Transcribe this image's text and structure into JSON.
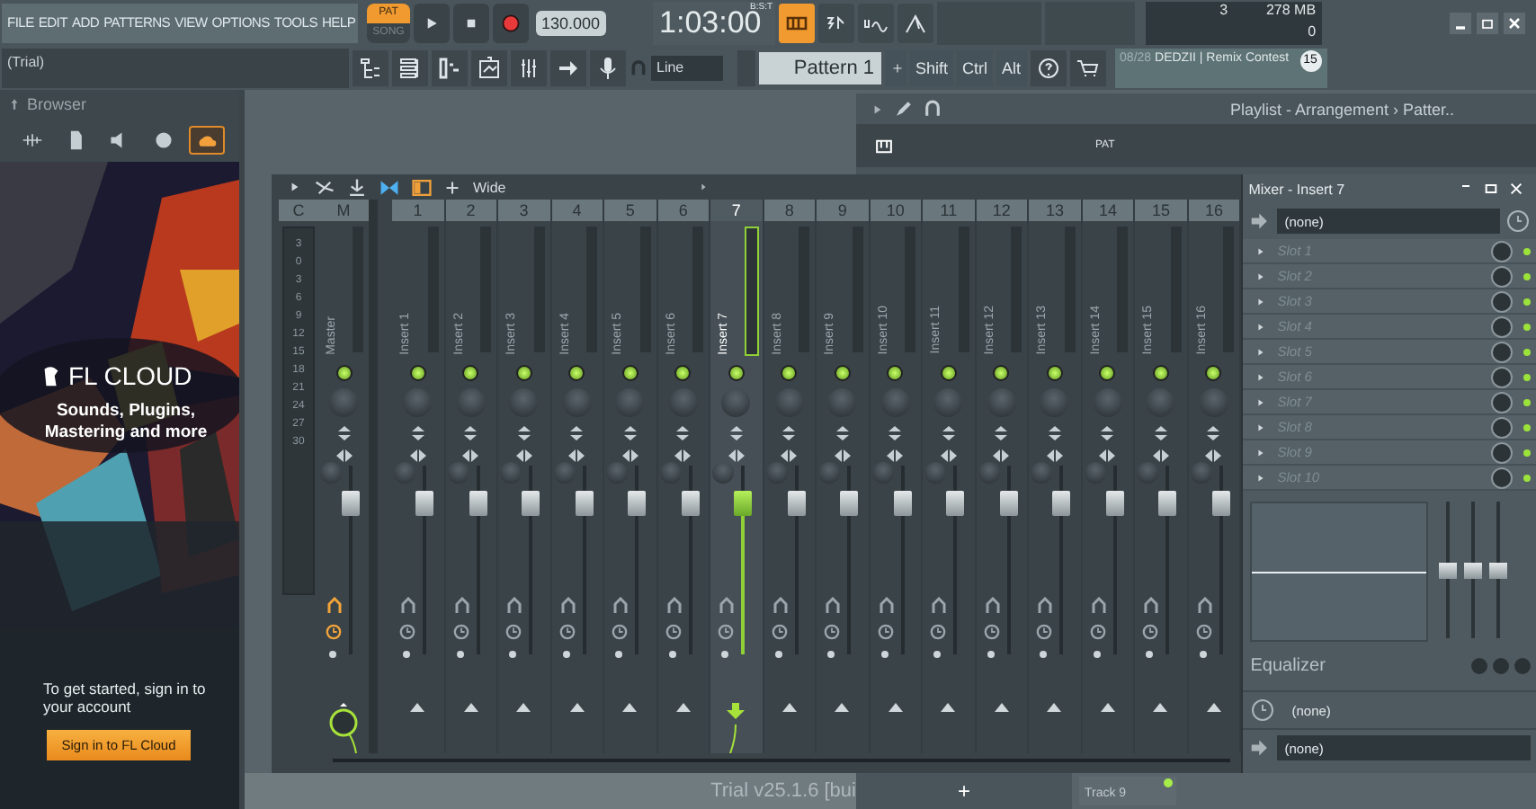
{
  "menu": [
    "FILE",
    "EDIT",
    "ADD",
    "PATTERNS",
    "VIEW",
    "OPTIONS",
    "TOOLS",
    "HELP"
  ],
  "transport": {
    "modes": [
      {
        "label": "PAT",
        "selected": true
      },
      {
        "label": "SONG",
        "selected": false
      }
    ],
    "recording": false,
    "tempo": "130.000",
    "time": "1:03:00",
    "time_unit": "B:S:T"
  },
  "hint": "(Trial)",
  "snap": "Line",
  "pattern": "Pattern 1",
  "keys": [
    "Shift",
    "Ctrl",
    "Alt"
  ],
  "monitor": {
    "cpu": "3",
    "memory": "278 MB",
    "polyphony": "0"
  },
  "news": {
    "date": "08/28",
    "title": "DEDZII | Remix Contest",
    "badge": "15"
  },
  "browser": {
    "title": "Browser",
    "tabs": [
      {
        "selected": false
      },
      {
        "selected": false
      },
      {
        "selected": false
      },
      {
        "selected": false
      },
      {
        "selected": true
      }
    ],
    "brand": "FL CLOUD",
    "tagline": "Sounds, Plugins, Mastering and more",
    "prompt": "To get started, sign in to your account",
    "button": "Sign in to FL Cloud"
  },
  "playlist": {
    "title": "Playlist - Arrangement › Patter..",
    "mode": "PAT"
  },
  "mixer": {
    "preset": "Wide",
    "scale": [
      "3",
      "0",
      "3",
      "6",
      "9",
      "12",
      "15",
      "18",
      "21",
      "24",
      "27",
      "30"
    ],
    "headers": [
      "C",
      "M",
      "1",
      "2",
      "3",
      "4",
      "5",
      "6",
      "7",
      "8",
      "9",
      "10",
      "11",
      "12",
      "13",
      "14",
      "15",
      "16"
    ],
    "tracks": [
      {
        "kind": "master",
        "name": "Master",
        "selected": false,
        "level": 0.85
      },
      {
        "kind": "insert",
        "name": "Insert 1",
        "selected": false,
        "level": 0.85
      },
      {
        "kind": "insert",
        "name": "Insert 2",
        "selected": false,
        "level": 0.85
      },
      {
        "kind": "insert",
        "name": "Insert 3",
        "selected": false,
        "level": 0.85
      },
      {
        "kind": "insert",
        "name": "Insert 4",
        "selected": false,
        "level": 0.85
      },
      {
        "kind": "insert",
        "name": "Insert 5",
        "selected": false,
        "level": 0.85
      },
      {
        "kind": "insert",
        "name": "Insert 6",
        "selected": false,
        "level": 0.85
      },
      {
        "kind": "insert",
        "name": "Insert 7",
        "selected": true,
        "level": 0.85
      },
      {
        "kind": "insert",
        "name": "Insert 8",
        "selected": false,
        "level": 0.85
      },
      {
        "kind": "insert",
        "name": "Insert 9",
        "selected": false,
        "level": 0.85
      },
      {
        "kind": "insert",
        "name": "Insert 10",
        "selected": false,
        "level": 0.85
      },
      {
        "kind": "insert",
        "name": "Insert 11",
        "selected": false,
        "level": 0.85
      },
      {
        "kind": "insert",
        "name": "Insert 12",
        "selected": false,
        "level": 0.85
      },
      {
        "kind": "insert",
        "name": "Insert 13",
        "selected": false,
        "level": 0.85
      },
      {
        "kind": "insert",
        "name": "Insert 14",
        "selected": false,
        "level": 0.85
      },
      {
        "kind": "insert",
        "name": "Insert 15",
        "selected": false,
        "level": 0.85
      },
      {
        "kind": "insert",
        "name": "Insert 16",
        "selected": false,
        "level": 0.85
      }
    ]
  },
  "insert_panel": {
    "title": "Mixer - Insert 7",
    "input": "(none)",
    "slots": [
      {
        "name": "Slot 1",
        "on": true
      },
      {
        "name": "Slot 2",
        "on": true
      },
      {
        "name": "Slot 3",
        "on": true
      },
      {
        "name": "Slot 4",
        "on": true
      },
      {
        "name": "Slot 5",
        "on": true
      },
      {
        "name": "Slot 6",
        "on": true
      },
      {
        "name": "Slot 7",
        "on": true
      },
      {
        "name": "Slot 8",
        "on": true
      },
      {
        "name": "Slot 9",
        "on": true
      },
      {
        "name": "Slot 10",
        "on": true
      }
    ],
    "eq_label": "Equalizer",
    "eq_bands": [
      {
        "level": 0.5
      },
      {
        "level": 0.5
      },
      {
        "level": 0.5
      }
    ],
    "latency": "(none)",
    "output": "(none)"
  },
  "status": {
    "version": "Trial v25.1.6 [bui",
    "add": "+",
    "track": "Track 9"
  }
}
